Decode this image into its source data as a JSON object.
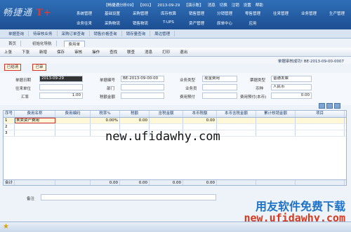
{
  "app": {
    "logo_text": "畅捷通",
    "logo_brand": "T+"
  },
  "header": {
    "status_items": [
      "【畅捷通分析09】",
      "【001】",
      "2013-09-29",
      "【演示账】",
      "消息",
      "切换",
      "注销",
      "设置",
      "帮助"
    ],
    "menu_row1": [
      "系统管理",
      "基础设置",
      "采购管理",
      "库存核算",
      "销售管理",
      "分销管理",
      "零售管理",
      "往来管理",
      "业务管理",
      "生产管理"
    ],
    "menu_row2": [
      "业务往来",
      "采购物流",
      "销售物流",
      "T-UPS",
      "资产管理",
      "原单中心",
      "应用"
    ]
  },
  "tabs": [
    "单据查询",
    "待审核业务",
    "采购订单查询",
    "销售价格查询",
    "销存量查询",
    "周边管理"
  ],
  "subnav": [
    "首页",
    "初始化导航",
    "费用单"
  ],
  "toolbar": [
    "上张",
    "下张",
    "新增",
    "保存",
    "审核",
    "操作",
    "查找",
    "联查",
    "消息",
    "打印",
    "退出"
  ],
  "message": "单据审核成功! BE-2013-09-00-0007",
  "red_buttons": [
    "已结清",
    "已审"
  ],
  "form": {
    "date_label": "单据日期",
    "date_value": "2013-09-29",
    "code_label": "单据编号",
    "code_value": "BE-2013-09-00-00",
    "biztype_label": "业务类型",
    "biztype_value": "现金费用",
    "invoice_label": "票据类型",
    "invoice_value": "普通发票",
    "settle_label": "往来单位",
    "dept_label": "部门",
    "staff_label": "业务员",
    "currency_label": "币种",
    "currency_value": "人民币",
    "rate_label": "汇率",
    "rate_value": "1.00",
    "tax_label": "税额金额",
    "prepay_label": "费用预付",
    "prepay2_label": "费用预付(本币)",
    "prepay2_value": "0.00"
  },
  "grid": {
    "columns": [
      "序号",
      "费用名称",
      "费用编码",
      "税率%",
      "税额",
      "含税金额",
      "本币税额",
      "本币含税金额",
      "累计核销金额",
      "项目"
    ],
    "rows": [
      [
        "1",
        "未卖资产费用",
        "",
        "0.00%",
        "0.00",
        "",
        "0.00",
        "",
        "",
        ""
      ],
      [
        "2",
        "",
        "",
        "",
        "",
        "",
        "",
        "",
        "",
        ""
      ],
      [
        "3",
        "",
        "",
        "",
        "",
        "",
        "",
        "",
        "",
        ""
      ]
    ],
    "totals": [
      "合计",
      "",
      "",
      "0.00",
      "0.00",
      "0.00",
      "0.00",
      "",
      "",
      ""
    ]
  },
  "remark_label": "备注",
  "watermark": "new.ufidawhy.com",
  "brand_footer_1": "用友软件免费下载",
  "brand_footer_2": "new.ufidawhy.com"
}
